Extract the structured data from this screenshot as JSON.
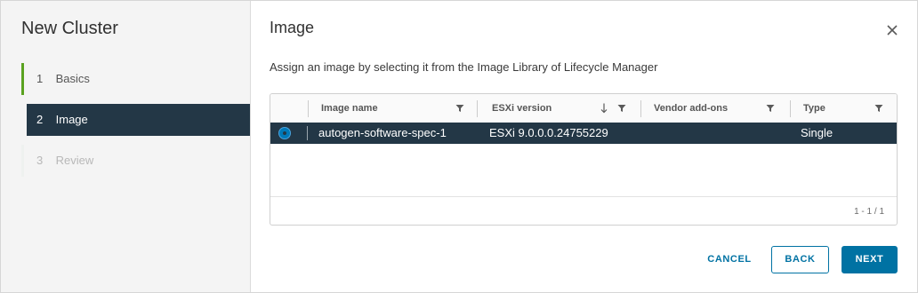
{
  "wizard": {
    "title": "New Cluster",
    "steps": [
      {
        "number": "1",
        "label": "Basics",
        "state": "completed"
      },
      {
        "number": "2",
        "label": "Image",
        "state": "active"
      },
      {
        "number": "3",
        "label": "Review",
        "state": "disabled"
      }
    ]
  },
  "page": {
    "title": "Image",
    "description": "Assign an image by selecting it from the Image Library of Lifecycle Manager"
  },
  "grid": {
    "columns": [
      {
        "label": "Image name",
        "filter_icon": "filter-icon"
      },
      {
        "label": "ESXi version",
        "sort_icon": "arrow-down-icon",
        "filter_icon": "filter-icon"
      },
      {
        "label": "Vendor add-ons",
        "filter_icon": "filter-icon"
      },
      {
        "label": "Type",
        "filter_icon": "filter-icon"
      }
    ],
    "rows": [
      {
        "selected": true,
        "image_name": "autogen-software-spec-1",
        "esxi_version": "ESXi 9.0.0.0.24755229",
        "vendor_addons": "",
        "type": "Single"
      }
    ],
    "pagination": "1 - 1 / 1"
  },
  "buttons": {
    "cancel": "CANCEL",
    "back": "BACK",
    "next": "NEXT"
  },
  "colors": {
    "selected_bg": "#233746",
    "accent": "#0072a3",
    "step_complete": "#5aa220"
  }
}
